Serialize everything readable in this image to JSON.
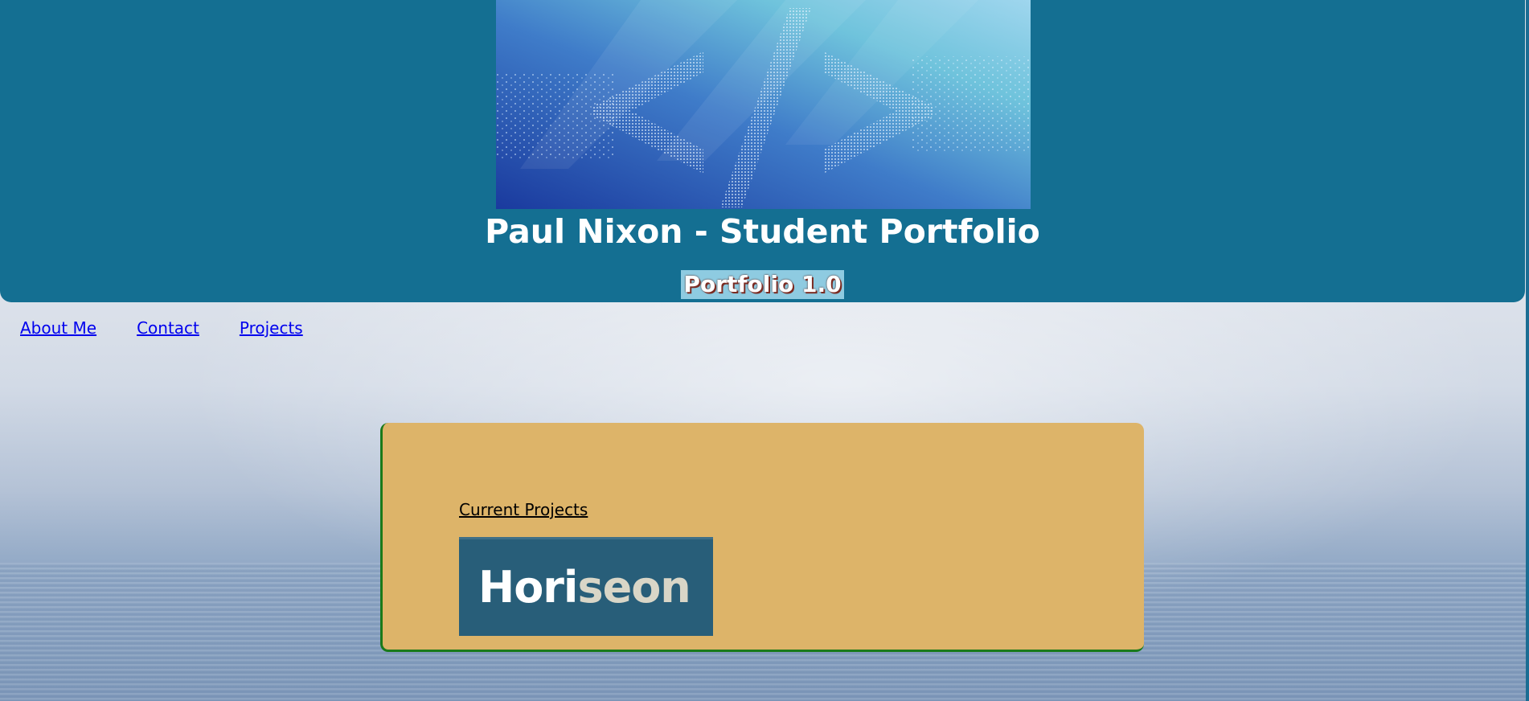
{
  "header": {
    "title": "Paul Nixon - Student Portfolio",
    "version": "Portfolio 1.0",
    "background_color": "#146f92",
    "hero_image": "code-brackets-banner"
  },
  "nav": {
    "items": [
      {
        "label": "About Me"
      },
      {
        "label": "Contact"
      },
      {
        "label": "Projects"
      }
    ],
    "link_color": "#0000ee"
  },
  "projects": {
    "heading": "Current Projects",
    "card_color": "#ddb469",
    "items": [
      {
        "logo_part1": "Hori",
        "logo_part2": "seon",
        "bg_color": "#285e79"
      }
    ]
  }
}
